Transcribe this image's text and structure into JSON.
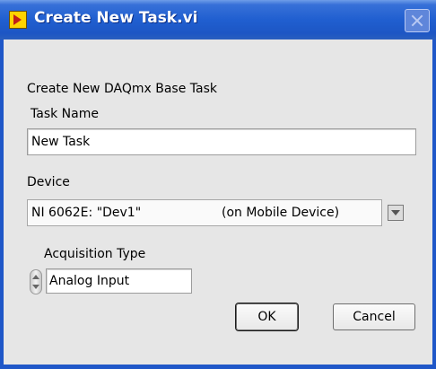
{
  "window": {
    "title": "Create New Task.vi"
  },
  "heading": "Create New DAQmx Base Task",
  "task_name": {
    "label": "Task Name",
    "value": "New Task"
  },
  "device": {
    "label": "Device",
    "name": "NI 6062E: \"Dev1\"",
    "location": "(on Mobile Device)"
  },
  "acquisition": {
    "label": "Acquisition Type",
    "value": "Analog Input"
  },
  "buttons": {
    "ok": "OK",
    "cancel": "Cancel"
  },
  "colors": {
    "title_bar": "#205fd0",
    "panel": "#e6e6e6",
    "frame": "#1f57c8"
  }
}
